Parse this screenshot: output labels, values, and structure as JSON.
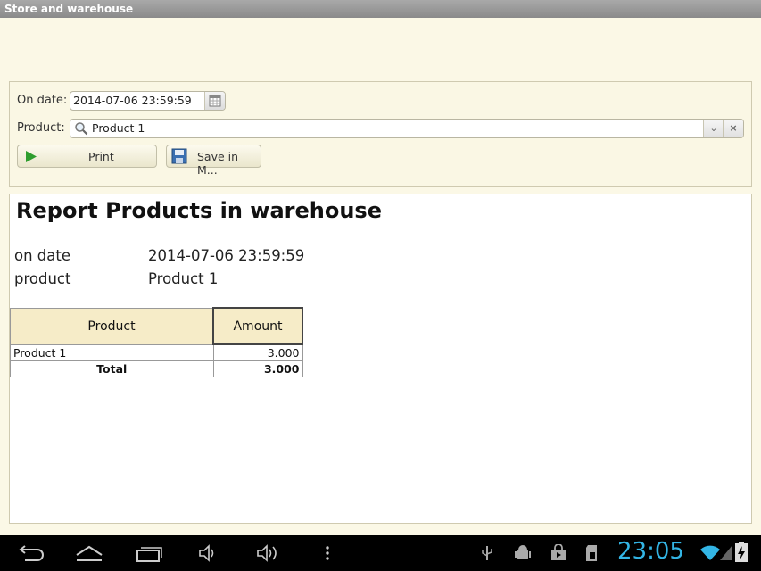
{
  "window": {
    "title": "Store and warehouse"
  },
  "params": {
    "date_label": "On date:",
    "date_value": "2014-07-06 23:59:59",
    "product_label": "Product:",
    "product_value": "Product 1",
    "print_button": "Print",
    "save_button": "Save in M..."
  },
  "report": {
    "title": "Report Products in warehouse",
    "on_date_label": "on date",
    "on_date_value": "2014-07-06 23:59:59",
    "product_label": "product",
    "product_value": "Product 1",
    "table": {
      "headers": [
        "Product",
        "Amount"
      ],
      "rows": [
        {
          "product": "Product 1",
          "amount": "3.000"
        }
      ],
      "total_label": "Total",
      "total_amount": "3.000"
    }
  },
  "statusbar": {
    "time": "23:05",
    "icons": [
      "usb-icon",
      "android-debug-icon",
      "store-icon",
      "sd-card-icon",
      "wifi-icon",
      "signal-icon",
      "battery-charging-icon"
    ]
  },
  "navbar": {
    "icons": [
      "back-icon",
      "home-icon",
      "recent-apps-icon",
      "volume-down-icon",
      "volume-up-icon",
      "menu-icon"
    ]
  },
  "colors": {
    "accent_clock": "#33b5e5",
    "header_bg": "#f6ecc8",
    "panel_bg": "#faf7e4"
  }
}
